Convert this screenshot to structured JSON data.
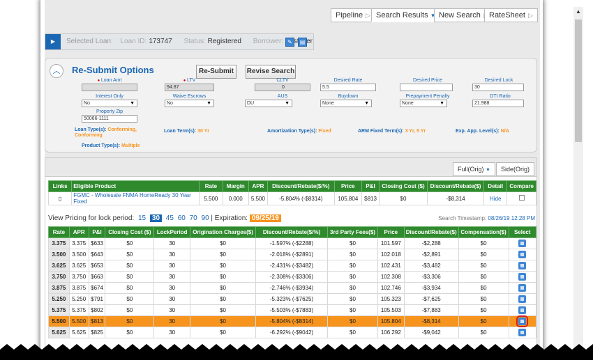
{
  "tabs": [
    {
      "label": "Pipeline"
    },
    {
      "label": "Search Results"
    },
    {
      "label": "New Search"
    },
    {
      "label": "RateSheet"
    }
  ],
  "loan_bar": {
    "selected_loan": "Selected Loan:",
    "loan_id_label": "Loan ID:",
    "loan_id": "173747",
    "status_label": "Status:",
    "status": "Registered",
    "borrower_label": "Borrower:",
    "borrower": "Firstimer"
  },
  "resubmit": {
    "title": "Re-Submit Options",
    "resubmit_button": "Re-Submit",
    "revise_button": "Revise Search",
    "fields": {
      "loan_amt": {
        "label": "Loan Amt",
        "value": ""
      },
      "ltv": {
        "label": "LTV",
        "value": "94.87"
      },
      "cltv": {
        "label": "CLTV",
        "value": "0"
      },
      "desired_rate": {
        "label": "Desired Rate",
        "value": "5.5"
      },
      "desired_price": {
        "label": "Desired Price",
        "value": ""
      },
      "desired_lock": {
        "label": "Desired Lock",
        "value": "30"
      },
      "interest_only": {
        "label": "Interest Only",
        "value": "No"
      },
      "waive_escrows": {
        "label": "Waive Escrows",
        "value": "No"
      },
      "aus": {
        "label": "AUS",
        "value": "DU"
      },
      "buydown": {
        "label": "Buydown",
        "value": "None"
      },
      "prepayment_penalty": {
        "label": "Prepayment Penalty",
        "value": "None"
      },
      "dti_ratio": {
        "label": "DTI Ratio",
        "value": "21.988"
      },
      "property_zip": {
        "label": "Property Zip",
        "value": "50066-1111"
      }
    },
    "summary": {
      "loan_types_label": "Loan Type(s):",
      "loan_types_value": "Conforming,",
      "loan_types_value2": "Conforming",
      "loan_term_label": "Loan Term(s):",
      "loan_term_value": "30 Yr",
      "amort_label": "Amortization Type(s):",
      "amort_value": "Fixed",
      "arm_label": "ARM Fixed Term(s):",
      "arm_value": "3 Yr, 5 Yr",
      "exp_label": "Exp. App. Level(s):",
      "exp_value": "N/A",
      "product_label": "Product Type(s):",
      "product_value": "Multiple"
    }
  },
  "view_tabs": [
    {
      "label": "Full(Orig)"
    },
    {
      "label": "Side(Orig)"
    }
  ],
  "product_table": {
    "headers": [
      "Links",
      "Eligible Product",
      "Rate",
      "Margin",
      "APR",
      "Discount/Rebate($/%)",
      "Price",
      "P&I",
      "Closing Cost ($)",
      "Discount/Rebate($)",
      "Detail",
      "Compare"
    ],
    "row": {
      "product": "FGMC - Wholesale FNMA HomeReady 30 Year Fixed",
      "rate": "5.500",
      "margin": "0.000",
      "apr": "5.500",
      "discount": "-5.804% (-$8314)",
      "price": "105.804",
      "pi": "$813",
      "closing": "$0",
      "rebate": "-$8,314",
      "detail": "Hide"
    }
  },
  "lock_row": {
    "label": "View Pricing for lock period:",
    "periods": [
      "15",
      "30",
      "45",
      "60",
      "70",
      "90"
    ],
    "selected": "30",
    "expiration_label": "| Expiration:",
    "expiration": "09/25/19",
    "timestamp_label": "Search Timestamp:",
    "timestamp": "08/26/19 12:28 PM"
  },
  "rate_table": {
    "headers": [
      "Rate",
      "APR",
      "P&I",
      "Closing Cost ($)",
      "LockPeriod",
      "Origination Charges($)",
      "Discount/Rebate($/%)",
      "3rd Party Fees($)",
      "Price",
      "Discount/Rebate($)",
      "Compensation($)",
      "Select"
    ],
    "rows": [
      [
        "3.375",
        "3.375",
        "$633",
        "$0",
        "30",
        "$0",
        "-1.597% (-$2288)",
        "$0",
        "101.597",
        "-$2,288",
        "$0"
      ],
      [
        "3.500",
        "3.500",
        "$643",
        "$0",
        "30",
        "$0",
        "-2.018% (-$2891)",
        "$0",
        "102.018",
        "-$2,891",
        "$0"
      ],
      [
        "3.625",
        "3.625",
        "$653",
        "$0",
        "30",
        "$0",
        "-2.431% (-$3482)",
        "$0",
        "102.431",
        "-$3,482",
        "$0"
      ],
      [
        "3.750",
        "3.750",
        "$663",
        "$0",
        "30",
        "$0",
        "-2.308% (-$3306)",
        "$0",
        "102.308",
        "-$3,306",
        "$0"
      ],
      [
        "3.875",
        "3.875",
        "$674",
        "$0",
        "30",
        "$0",
        "-2.746% (-$3934)",
        "$0",
        "102.746",
        "-$3,934",
        "$0"
      ],
      [
        "5.250",
        "5.250",
        "$791",
        "$0",
        "30",
        "$0",
        "-5.323% (-$7625)",
        "$0",
        "105.323",
        "-$7,625",
        "$0"
      ],
      [
        "5.375",
        "5.375",
        "$802",
        "$0",
        "30",
        "$0",
        "-5.503% (-$7883)",
        "$0",
        "105.503",
        "-$7,883",
        "$0"
      ],
      [
        "5.500",
        "5.500",
        "$813",
        "$0",
        "30",
        "$0",
        "-5.804% (-$8314)",
        "$0",
        "105.804",
        "-$8,314",
        "$0"
      ],
      [
        "5.625",
        "5.625",
        "$825",
        "$0",
        "30",
        "$0",
        "-6.292% (-$9042)",
        "$0",
        "106.292",
        "-$9,042",
        "$0"
      ]
    ],
    "highlight_index": 7
  },
  "colors": {
    "header_green": "#2f8a2e",
    "brand_blue": "#1b67b3",
    "highlight_orange": "#f7941d",
    "callout_red": "#d42121"
  }
}
